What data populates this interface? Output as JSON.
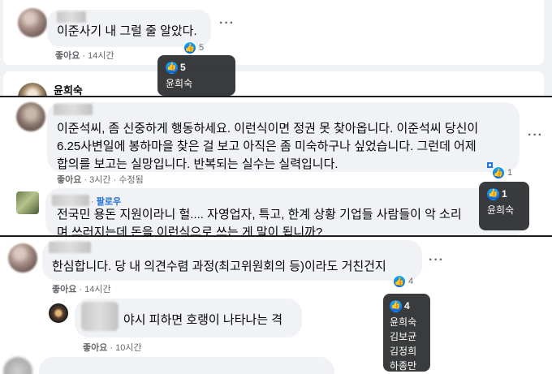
{
  "panel1": {
    "comment_text": "이준사기 내 그럴 줄 알았다.",
    "like_label": "좋아요",
    "time": "14시간",
    "reaction_count": "5",
    "tooltip": {
      "count": "5",
      "names": [
        "윤희숙"
      ]
    },
    "next_author": "윤희숙"
  },
  "panel2": {
    "comment_lines": [
      "이준석씨, 좀 신중하게 행동하세요. 이런식이면 정권 못 찾아옵니다. 이준석씨 당신이",
      "6.25사변일에 봉하마을 찾은 걸 보고 아직은 좀 미숙하구나 싶었습니다. 그런데 어제",
      "합의를 보고는 실망입니다. 반복되는 실수는 실력입니다."
    ],
    "like_label": "좋아요",
    "time": "3시간",
    "edited": "수정됨",
    "reaction_count": "1",
    "tooltip": {
      "count": "1",
      "names": [
        "윤희숙"
      ]
    },
    "follow_label": "팔로우",
    "second_comment_lines": [
      "전국민 용돈 지원이라니 헐.... 자영업자, 특고, 한계 상황 기업들 사람들이 악 소리",
      "며 쓰러지는데 돈을 이런식으로 쓰는 게 말이 됩니까?"
    ]
  },
  "panel3": {
    "comment_text": "한심합니다. 당 내 의견수렴 과정(최고위원회의 등)이라도 거친건지",
    "like_label": "좋아요",
    "time": "14시간",
    "reaction_count": "4",
    "tooltip": {
      "count": "4",
      "names": [
        "윤희숙",
        "김보균",
        "김정희",
        "하종만"
      ]
    },
    "reply_text": "야시 피하면 호랭이 나타나는 격",
    "reply_like_label": "좋아요",
    "reply_time": "10시간"
  }
}
